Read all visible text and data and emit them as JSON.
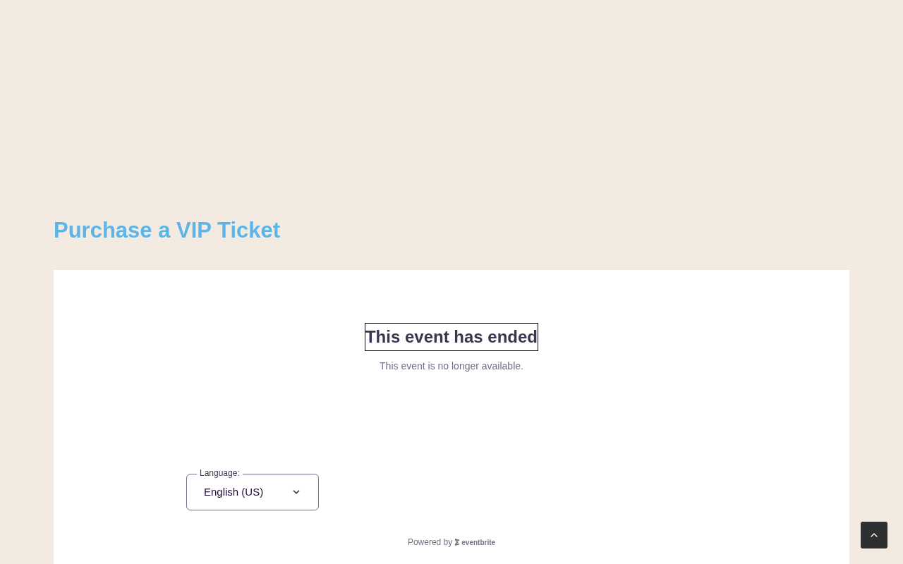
{
  "page": {
    "title": "Purchase a VIP Ticket"
  },
  "notice": {
    "heading": "This event has ended",
    "focused": true,
    "message": "This event is no longer available."
  },
  "language": {
    "label": "Language:",
    "value": "English (US)"
  },
  "footer": {
    "powered_by": "Powered by",
    "brand": "eventbrite"
  }
}
